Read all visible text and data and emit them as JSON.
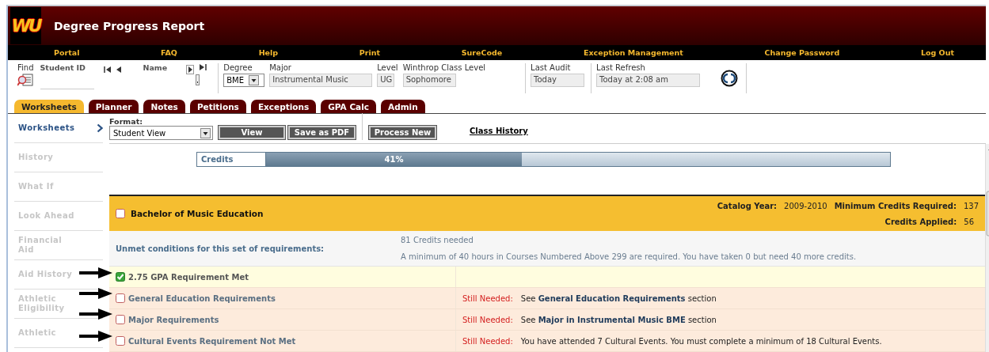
{
  "header": {
    "logo": "WU",
    "title": "Degree Progress Report"
  },
  "nav": [
    "Portal",
    "FAQ",
    "Help",
    "Print",
    "SureCode",
    "Exception Management",
    "Change Password",
    "Log Out"
  ],
  "student": {
    "find_label": "Find",
    "student_id_label": "Student ID",
    "name_label": "Name",
    "fields": [
      {
        "kind": "select",
        "label": "Degree",
        "value": "BME"
      },
      {
        "kind": "text",
        "label": "Major",
        "value": "Instrumental Music"
      },
      {
        "kind": "text",
        "label": "Level",
        "value": "UG"
      },
      {
        "kind": "text",
        "label": "Winthrop Class Level",
        "value": "Sophomore"
      },
      {
        "kind": "text",
        "label": "Last Audit",
        "value": "Today"
      },
      {
        "kind": "text",
        "label": "Last Refresh",
        "value": "Today at 2:08 am"
      }
    ]
  },
  "tabs": [
    {
      "label": "Worksheets",
      "selected": true
    },
    {
      "label": "Planner",
      "selected": false
    },
    {
      "label": "Notes",
      "selected": false
    },
    {
      "label": "Petitions",
      "selected": false
    },
    {
      "label": "Exceptions",
      "selected": false
    },
    {
      "label": "GPA Calc",
      "selected": false
    },
    {
      "label": "Admin",
      "selected": false
    }
  ],
  "sidebar": {
    "items": [
      {
        "label": "Worksheets",
        "selected": true
      },
      {
        "label": "History",
        "selected": false
      },
      {
        "label": "What If",
        "selected": false
      },
      {
        "label": "Look Ahead",
        "selected": false
      },
      {
        "label": "Financial Aid",
        "selected": false
      },
      {
        "label": "Aid History",
        "selected": false
      },
      {
        "label": "Athletic Eligibility",
        "selected": false
      },
      {
        "label": "Athletic",
        "selected": false
      }
    ]
  },
  "toolbar": {
    "format_label": "Format:",
    "format": "Student View",
    "buttons": [
      "View",
      "Save as PDF",
      "Process New"
    ],
    "link": "Class History"
  },
  "progress": {
    "label": "Credits",
    "level": 0.41,
    "reading": "41%"
  },
  "block": {
    "title": "Bachelor of Music Education",
    "checked": false,
    "catalog_year_label": "Catalog Year:",
    "catalog_year": "2009-2010",
    "min_credits_label": "Minimum Credits Required:",
    "min_credits": "137",
    "credits_applied_label": "Credits Applied:",
    "credits_applied": "56",
    "unmet_label": "Unmet conditions for this set of requirements:",
    "unmet_conditions": [
      "81 Credits needed",
      "A minimum of 40 hours in Courses Numbered Above 299 are required. You have taken 0 but need 40 more credits."
    ],
    "requirements": [
      {
        "title": "2.75 GPA Requirement Met",
        "checked": true
      },
      {
        "title": "General Education Requirements",
        "checked": false,
        "status": "Still Needed:",
        "detail": "See **General Education Requirements** section"
      },
      {
        "title": "Major Requirements",
        "checked": false,
        "status": "Still Needed:",
        "detail": "See **Major in Instrumental Music BME** section"
      },
      {
        "title": "Cultural Events Requirement Not Met",
        "checked": false,
        "status": "Still Needed:",
        "detail": "You have attended 7 Cultural Events. You must complete a minimum of 18 Cultural Events."
      }
    ]
  }
}
